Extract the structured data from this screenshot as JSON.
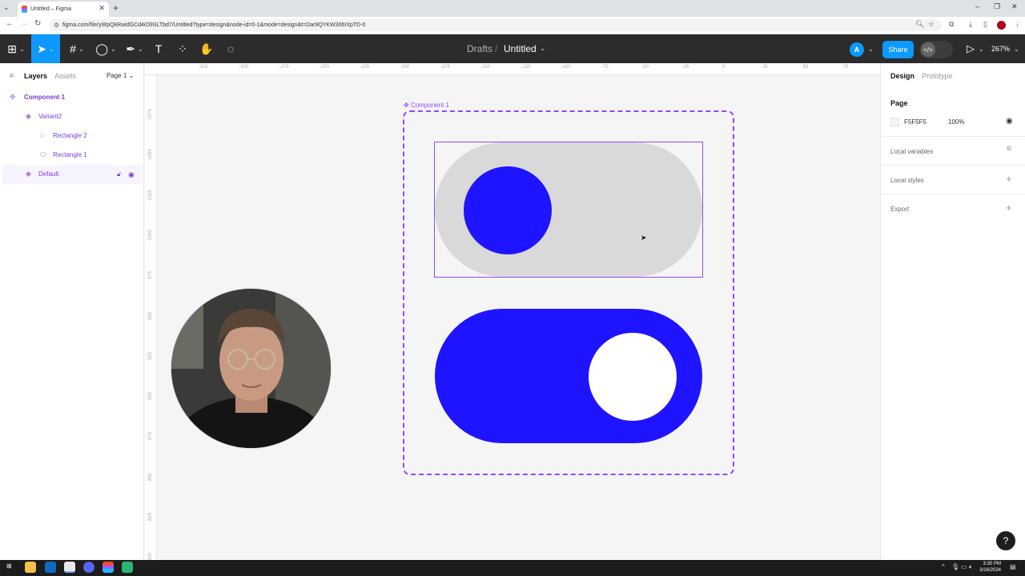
{
  "browser": {
    "tab_title": "Untitled – Figma",
    "url": "figma.com/file/yWpQkRwidGCd4iO9SLTbd7/Untitled?type=design&node-id=0-1&mode=design&t=Dar9QYKW306IXpTD-0"
  },
  "toolbar": {
    "breadcrumb_parent": "Drafts",
    "breadcrumb_separator": "/",
    "file_title": "Untitled",
    "avatar_letter": "A",
    "share_label": "Share",
    "zoom": "267%"
  },
  "left_panel": {
    "tabs": [
      "Layers",
      "Assets"
    ],
    "page_selector": "Page 1",
    "layers": [
      {
        "name": "Component 1"
      },
      {
        "name": "Variant2"
      },
      {
        "name": "Rectangle 2"
      },
      {
        "name": "Rectangle 1"
      },
      {
        "name": "Default"
      }
    ]
  },
  "canvas": {
    "component_label": "Component 1",
    "ruler_top": [
      "-325",
      "-300",
      "-275",
      "-250",
      "-225",
      "-200",
      "-175",
      "-150",
      "-125",
      "-100",
      "-75",
      "-50",
      "-25",
      "0",
      "25",
      "50",
      "75"
    ],
    "ruler_left": [
      "1075",
      "1050",
      "1025",
      "1000",
      "975",
      "950",
      "925",
      "900",
      "875",
      "850",
      "825",
      "800"
    ],
    "colors": {
      "accent": "#9747ff",
      "toggle_blue": "#1f14ff",
      "toggle_grey": "#d9d9d9"
    }
  },
  "right_panel": {
    "tabs": [
      "Design",
      "Prototype"
    ],
    "page_heading": "Page",
    "page_color_hex": "F5F5F5",
    "page_opacity": "100%",
    "sections": [
      "Local variables",
      "Local styles",
      "Export"
    ]
  },
  "help": "?",
  "taskbar": {
    "time": "3:30 PM",
    "date": "3/16/2024"
  }
}
